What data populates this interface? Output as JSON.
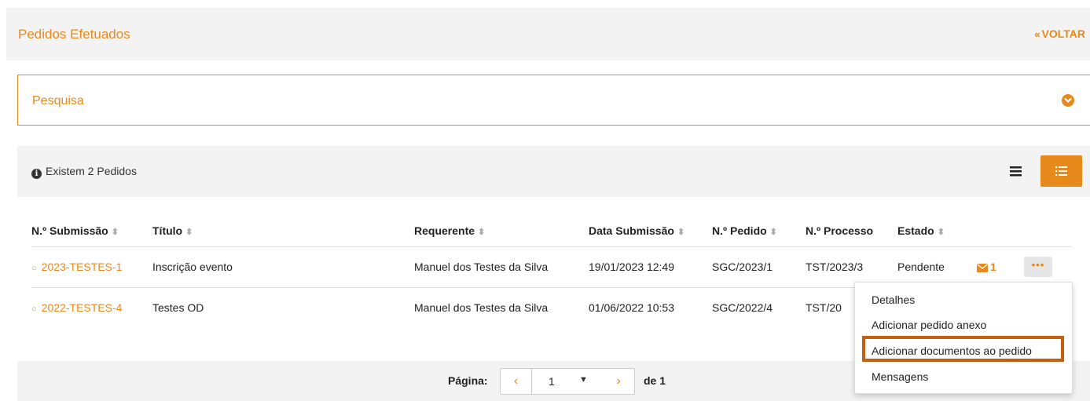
{
  "header": {
    "title": "Pedidos Efetuados",
    "back_label": "VOLTAR",
    "back_icon": "double-chevron-left-icon"
  },
  "search": {
    "label": "Pesquisa",
    "toggle_icon": "chevron-down-circle-icon"
  },
  "results": {
    "count_text": "Existem 2 Pedidos",
    "columns": [
      "N.º Submissão",
      "Título",
      "Requerente",
      "Data Submissão",
      "N.º Pedido",
      "N.º Processo",
      "Estado"
    ],
    "rows": [
      {
        "submission": "2023-TESTES-1",
        "title": "Inscrição evento",
        "requester": "Manuel dos Testes da Silva",
        "date": "19/01/2023 12:49",
        "request_no": "SGC/2023/1",
        "process_no": "TST/2023/3",
        "status": "Pendente",
        "messages": "1",
        "actions": "•••"
      },
      {
        "submission": "2022-TESTES-4",
        "title": "Testes OD",
        "requester": "Manuel dos Testes da Silva",
        "date": "01/06/2022 10:53",
        "request_no": "SGC/2022/4",
        "process_no": "TST/20"
      }
    ]
  },
  "pagination": {
    "label": "Página:",
    "current": "1",
    "total": "de 1"
  },
  "context_menu": {
    "items": [
      "Detalhes",
      "Adicionar pedido anexo",
      "Adicionar documentos ao pedido",
      "Mensagens"
    ],
    "highlighted_index": 2
  },
  "colors": {
    "accent": "#e8891b",
    "highlight_border": "#c25f13",
    "header_bg": "#f3f3f3"
  }
}
